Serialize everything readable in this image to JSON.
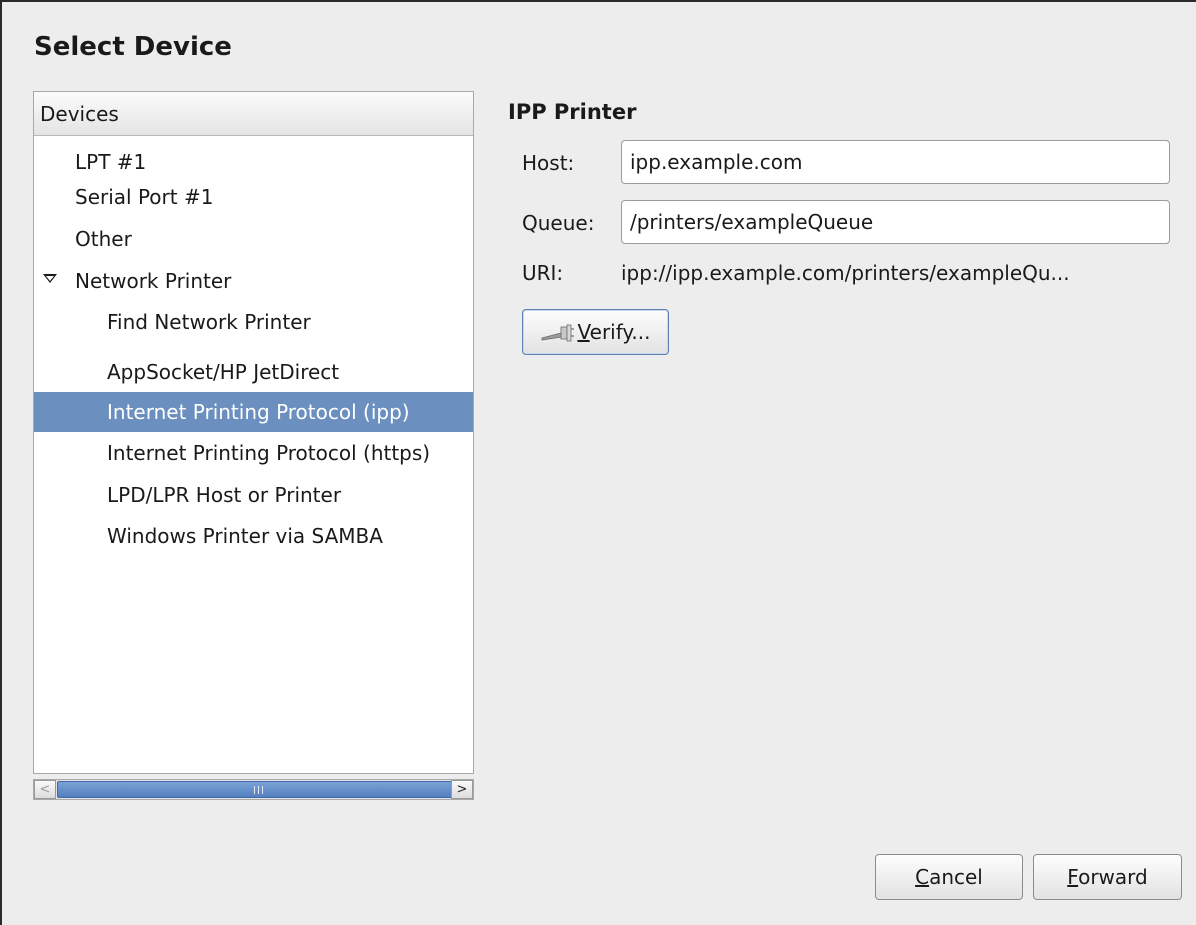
{
  "dialog": {
    "title": "Select Device"
  },
  "devices": {
    "header": "Devices",
    "items": [
      {
        "label": "LPT #1",
        "level": 1
      },
      {
        "label": "Serial Port #1",
        "level": 1
      },
      {
        "label": "Other",
        "level": 1
      },
      {
        "label": "Network Printer",
        "level": 1,
        "expanded": true
      },
      {
        "label": "Find Network Printer",
        "level": 2
      },
      {
        "label": "AppSocket/HP JetDirect",
        "level": 2
      },
      {
        "label": "Internet Printing Protocol (ipp)",
        "level": 2,
        "selected": true
      },
      {
        "label": "Internet Printing Protocol (https)",
        "level": 2
      },
      {
        "label": "LPD/LPR Host or Printer",
        "level": 2
      },
      {
        "label": "Windows Printer via SAMBA",
        "level": 2
      }
    ]
  },
  "scrollbar": {
    "left_arrow": "<",
    "right_arrow": ">"
  },
  "ipp": {
    "section_title": "IPP Printer",
    "host_label": "Host:",
    "host_value": "ipp.example.com",
    "queue_label": "Queue:",
    "queue_value": "/printers/exampleQueue",
    "uri_label": "URI:",
    "uri_value": "ipp://ipp.example.com/printers/exampleQu...",
    "verify_mnemonic": "V",
    "verify_rest": "erify..."
  },
  "footer": {
    "cancel_mnemonic": "C",
    "cancel_rest": "ancel",
    "forward_mnemonic": "F",
    "forward_rest": "orward"
  },
  "colors": {
    "selection": "#6b8fbf",
    "background": "#ededed"
  }
}
